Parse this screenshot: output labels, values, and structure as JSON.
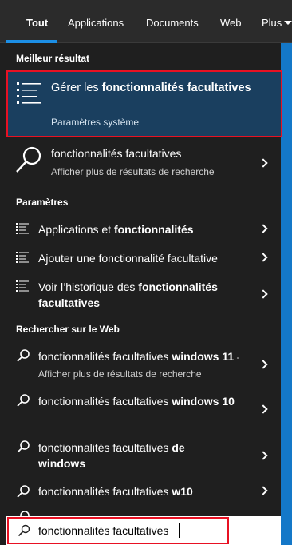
{
  "tabs": {
    "all": "Tout",
    "applications": "Applications",
    "documents": "Documents",
    "web": "Web",
    "more": "Plus"
  },
  "sections": {
    "best_result": "Meilleur résultat",
    "settings": "Paramètres",
    "web_search": "Rechercher sur le Web"
  },
  "best_result": {
    "title_pre": "Gérer les ",
    "title_bold": "fonctionnalités facultatives",
    "subtitle": "Paramètres système"
  },
  "search_more": {
    "title": "fonctionnalités facultatives",
    "subtitle": "Afficher plus de résultats de recherche"
  },
  "settings_items": [
    {
      "pre": "Applications et ",
      "bold": "fonctionnalités",
      "post": ""
    },
    {
      "pre": "Ajouter une fonctionnalité facultative",
      "bold": "",
      "post": ""
    },
    {
      "pre": "Voir l’historique des ",
      "bold": "fonctionnalités facultatives",
      "post": ""
    }
  ],
  "web_items": [
    {
      "pre": "fonctionnalités facultatives ",
      "bold": "windows 11",
      "suffix": " - Afficher plus de résultats de recherche"
    },
    {
      "pre": "fonctionnalités facultatives ",
      "bold": "windows 10",
      "suffix": ""
    },
    {
      "pre": "fonctionnalités facultatives ",
      "bold": "de windows",
      "suffix": ""
    },
    {
      "pre": "fonctionnalités facultatives ",
      "bold": "w10",
      "suffix": ""
    }
  ],
  "search": {
    "value": "fonctionnalités facultatives"
  },
  "colors": {
    "accent": "#1c8fe6",
    "highlight_border": "#e81123",
    "best_bg": "#1a3f5f",
    "panel_bg": "#1f1f1f",
    "desktop": "#1478c8"
  }
}
